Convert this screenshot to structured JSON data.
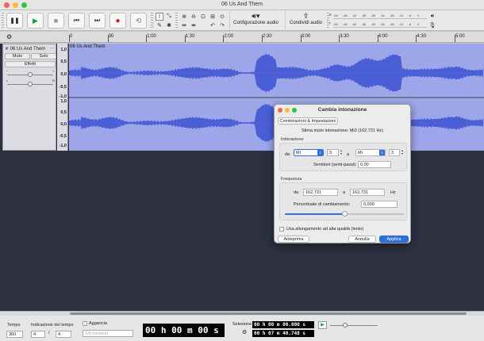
{
  "window": {
    "title": "06 Us And Them"
  },
  "toolbar": {
    "pause_glyph": "❚❚",
    "play_glyph": "▶",
    "stop_glyph": "■",
    "skip_start_glyph": "⏮",
    "skip_end_glyph": "⏭",
    "record_glyph": "●",
    "loop_glyph": "⟲",
    "audio_setup_label": "Configurazione audio",
    "share_audio_label": "Condividi audio",
    "meter_ticks": [
      "-54",
      "-48",
      "-42",
      "-36",
      "-30",
      "-24",
      "-18",
      "-12",
      "-6",
      "0"
    ],
    "meter_r": "R",
    "meter_l": "L"
  },
  "ruler": {
    "ticks": [
      "0",
      "30",
      "1:00",
      "1:30",
      "2:00",
      "2:30",
      "3:00",
      "3:30",
      "4:00",
      "4:30",
      "5:00"
    ]
  },
  "track": {
    "name": "06 Us And Them",
    "close_glyph": "✕",
    "menu_glyph": "···",
    "mute_label": "Muto",
    "solo_label": "Solo",
    "effects_label": "Effetti",
    "scale_top": [
      "1,0",
      "0,5",
      "0,0",
      "-0,5",
      "-1,0"
    ],
    "scale_bottom": [
      "1,0",
      "0,5",
      "0,0",
      "-0,5",
      "-1,0"
    ]
  },
  "dialog": {
    "title": "Cambia intonazione",
    "presets_label": "Combinazioni & Impostazioni",
    "estimate": "Stima inizio intonazione: Mi3 (162,731 Hz)",
    "pitch_group": "Intonazione",
    "from_label": "da",
    "from_note": "Mi",
    "from_octave": "3",
    "to_label": "a",
    "to_note": "Mi",
    "to_octave": "3",
    "semitones_label": "Semitoni (semi-passi):",
    "semitones_value": "0,00",
    "freq_group": "Frequenza",
    "freq_from_label": "da",
    "freq_from_value": "162,731",
    "freq_to_label": "a",
    "freq_to_value": "162,731",
    "hz_label": "Hz",
    "percent_label": "Percentuale di cambiamento:",
    "percent_value": "0,000",
    "percent_slider_value": 0.5,
    "hq_label": "Usa allungamento ad alta qualità (lento)",
    "preview_label": "Anteprima",
    "cancel_label": "Annulla",
    "apply_label": "Applica"
  },
  "bottom": {
    "tempo_label": "Tempo",
    "tempo_value": "360",
    "timesig_label": "Indicazione del tempo",
    "timesig_num": "4",
    "timesig_sep": "/",
    "timesig_den": "4",
    "snap_label": "Aggancia",
    "snap_value": "1/8 (terzine)",
    "time_display": "00 h 00 m 00 s",
    "selection_label": "Selezione",
    "sel_start": "00 h 00 m 00.000 s",
    "sel_end": "00 h 07 m 40.748 s"
  },
  "colors": {
    "waveform": "#4a5fd6",
    "track_bg": "#9ca6e8",
    "accent": "#2f6fe0"
  }
}
